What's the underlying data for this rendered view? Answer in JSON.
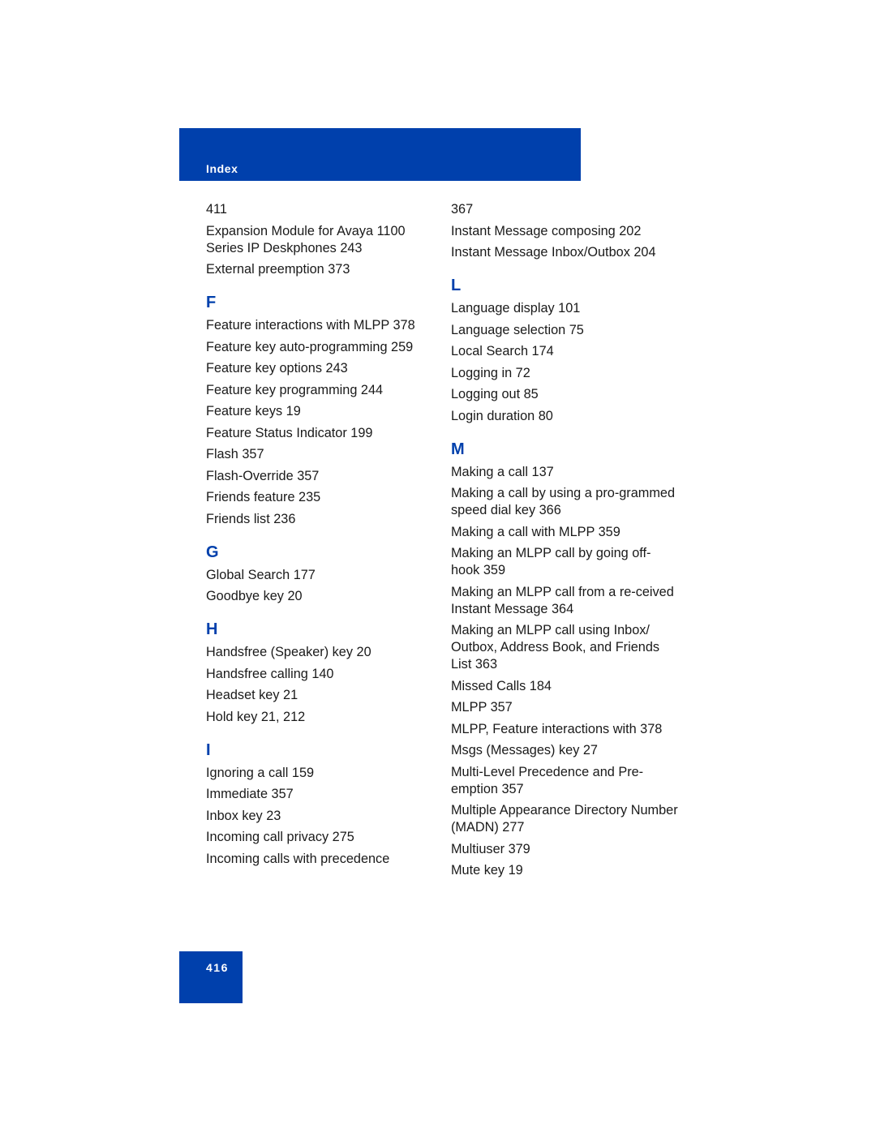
{
  "header": {
    "title": "Index",
    "color": "#0040ac"
  },
  "left_column": {
    "continued_entries": [
      "411",
      "Expansion Module for Avaya 1100 Series IP Deskphones 243",
      "External preemption 373"
    ],
    "sections": [
      {
        "letter": "F",
        "entries": [
          "Feature interactions with MLPP 378",
          "Feature key auto-programming 259",
          "Feature key options 243",
          "Feature key programming 244",
          "Feature keys 19",
          "Feature Status Indicator 199",
          "Flash 357",
          "Flash-Override 357",
          "Friends feature 235",
          "Friends list 236"
        ]
      },
      {
        "letter": "G",
        "entries": [
          "Global Search 177",
          "Goodbye key 20"
        ]
      },
      {
        "letter": "H",
        "entries": [
          "Handsfree (Speaker) key 20",
          "Handsfree calling 140",
          "Headset key 21",
          "Hold key 21, 212"
        ]
      },
      {
        "letter": "I",
        "entries": [
          "Ignoring a call 159",
          "Immediate 357",
          "Inbox key 23",
          "Incoming call privacy 275",
          "Incoming calls with precedence"
        ]
      }
    ]
  },
  "right_column": {
    "continued_entries": [
      "367",
      "Instant Message composing 202",
      "Instant Message Inbox/Outbox 204"
    ],
    "sections": [
      {
        "letter": "L",
        "entries": [
          "Language display 101",
          "Language selection 75",
          "Local Search 174",
          "Logging in 72",
          "Logging out 85",
          "Login duration 80"
        ]
      },
      {
        "letter": "M",
        "entries": [
          "Making a call 137",
          "Making a call by using a pro-grammed speed dial key 366",
          "Making a call with MLPP 359",
          "Making an MLPP call by going off-hook 359",
          "Making an MLPP call from a re-ceived Instant Message 364",
          "Making an MLPP call using Inbox/ Outbox, Address Book, and Friends List 363",
          "Missed Calls 184",
          "MLPP 357",
          "MLPP, Feature interactions with 378",
          "Msgs (Messages) key 27",
          "Multi-Level Precedence and Pre-emption 357",
          "Multiple Appearance Directory Number (MADN) 277",
          "Multiuser 379",
          "Mute key 19"
        ]
      }
    ]
  },
  "footer": {
    "page_number": "416"
  }
}
